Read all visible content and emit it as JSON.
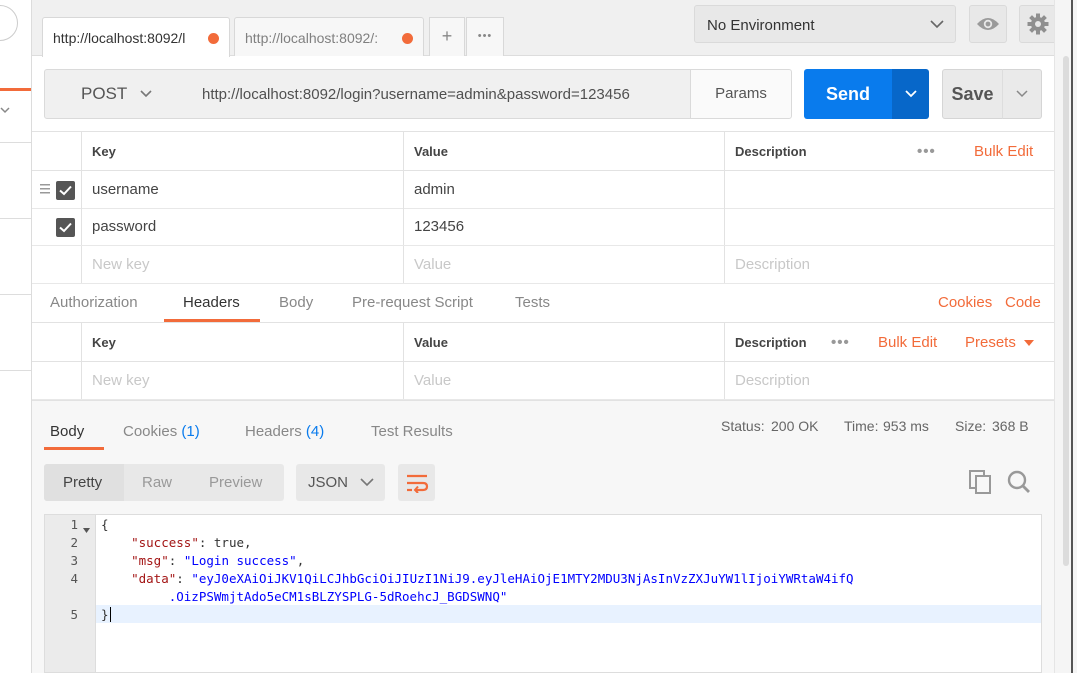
{
  "tabs": [
    {
      "label": "http://localhost:8092/l"
    },
    {
      "label": "http://localhost:8092/:"
    }
  ],
  "tab_actions": {
    "add": "+",
    "more": "•••"
  },
  "environment": {
    "selected": "No Environment"
  },
  "request": {
    "method": "POST",
    "url": "http://localhost:8092/login?username=admin&password=123456",
    "params_label": "Params",
    "send_label": "Send",
    "save_label": "Save"
  },
  "params_table": {
    "headers": {
      "key": "Key",
      "value": "Value",
      "description": "Description"
    },
    "bulk_edit": "Bulk Edit",
    "rows": [
      {
        "key": "username",
        "value": "admin",
        "description": ""
      },
      {
        "key": "password",
        "value": "123456",
        "description": ""
      }
    ],
    "placeholders": {
      "key": "New key",
      "value": "Value",
      "description": "Description"
    }
  },
  "request_tabs": {
    "items": [
      "Authorization",
      "Headers",
      "Body",
      "Pre-request Script",
      "Tests"
    ],
    "active": "Headers",
    "cookies_link": "Cookies",
    "code_link": "Code"
  },
  "headers_table": {
    "headers": {
      "key": "Key",
      "value": "Value",
      "description": "Description"
    },
    "bulk_edit": "Bulk Edit",
    "presets": "Presets",
    "placeholders": {
      "key": "New key",
      "value": "Value",
      "description": "Description"
    }
  },
  "response": {
    "tabs": {
      "body": "Body",
      "cookies": "Cookies",
      "cookies_count": "(1)",
      "headers": "Headers",
      "headers_count": "(4)",
      "tests": "Test Results"
    },
    "status_label": "Status:",
    "status_value": "200 OK",
    "time_label": "Time:",
    "time_value": "953 ms",
    "size_label": "Size:",
    "size_value": "368 B",
    "formats": [
      "Pretty",
      "Raw",
      "Preview"
    ],
    "active_format": "Pretty",
    "language": "JSON",
    "lines": [
      "1",
      "2",
      "3",
      "4",
      "5"
    ],
    "body": {
      "open": "{",
      "k_success": "\"success\"",
      "v_success": "true",
      "k_msg": "\"msg\"",
      "v_msg": "\"Login success\"",
      "k_data": "\"data\"",
      "v_data_1": "\"eyJ0eXAiOiJKV1QiLCJhbGciOiJIUzI1NiJ9.eyJleHAiOjE1MTY2MDU3NjAsInVzZXJuYW1lIjoiYWRtaW4ifQ",
      "v_data_2": ".OizPSWmjtAdo5eCM1sBLZYSPLG-5dRoehcJ_BGDSWNQ\"",
      "close": "}"
    }
  },
  "colors": {
    "accent": "#f26b3a",
    "send": "#097bed",
    "link": "#097bed"
  }
}
